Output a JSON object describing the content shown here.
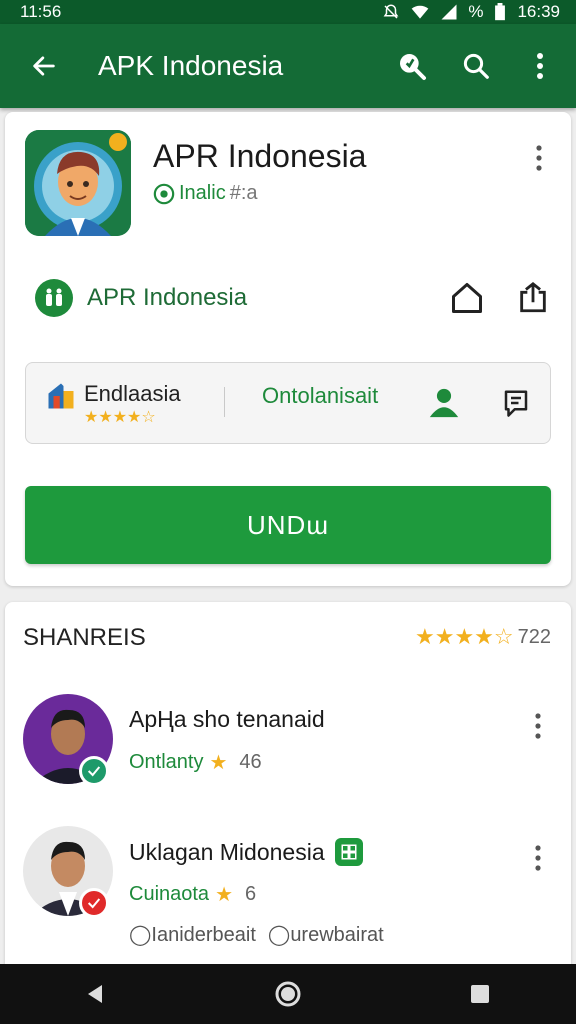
{
  "status_bar": {
    "time_left": "11:56",
    "time_right": "16:39",
    "percent_symbol": "%"
  },
  "app_bar": {
    "title": "APK Indonesia"
  },
  "app": {
    "name": "APR Indonesia",
    "subtitle_main": "Inalic",
    "subtitle_muted": "#:a"
  },
  "developer": {
    "name": "APR Indonesia"
  },
  "info": {
    "left_label": "Endlaasia",
    "left_stars": "★★★★☆",
    "center_label": "Ontolanisait"
  },
  "install_button": {
    "label": "UNDɯ"
  },
  "reviews_section": {
    "title": "SHANREIS",
    "stars": "★★★★☆",
    "count": "722",
    "items": [
      {
        "name": "ApҢa sho tenanaid",
        "meta_label": "Ontlanty",
        "meta_count": "46"
      },
      {
        "name": "Uklagan Midonesia",
        "meta_label": "Cuinaota",
        "meta_count": "6",
        "tag_1": "Ianiderbeait",
        "tag_2": "urewbairat"
      }
    ]
  },
  "colors": {
    "primary": "#146b36",
    "status": "#0c5a2a",
    "accent": "#1e9a3d",
    "star": "#f2b01e"
  },
  "icons": [
    "back-arrow-icon",
    "shield-search-icon",
    "search-icon",
    "more-vert-icon",
    "home-icon",
    "share-icon",
    "person-icon",
    "comment-icon",
    "back-nav-icon",
    "home-nav-icon",
    "recents-nav-icon"
  ]
}
